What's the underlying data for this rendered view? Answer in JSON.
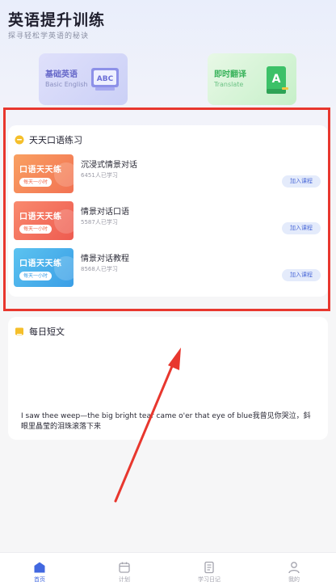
{
  "header": {
    "title": "英语提升训练",
    "subtitle": "探寻轻松学英语的秘诀"
  },
  "features": [
    {
      "title": "基础英语",
      "subtitle": "Basic English",
      "icon": "abc-book-icon",
      "icon_text": "ABC"
    },
    {
      "title": "即时翻译",
      "subtitle": "Translate",
      "icon": "translate-book-icon",
      "icon_text": "A"
    }
  ],
  "practice": {
    "title": "天天口语练习",
    "icon": "chat-bubble-icon",
    "courses": [
      {
        "thumb_title": "口语天天练",
        "thumb_tag": "每天一小时",
        "name": "沉浸式情景对话",
        "count": "6451人已学习",
        "join": "加入课程"
      },
      {
        "thumb_title": "口语天天练",
        "thumb_tag": "每天一小时",
        "name": "情景对话口语",
        "count": "5587人已学习",
        "join": "加入课程"
      },
      {
        "thumb_title": "口语天天练",
        "thumb_tag": "每天一小时",
        "name": "情景对话教程",
        "count": "8568人已学习",
        "join": "加入课程"
      }
    ]
  },
  "daily": {
    "title": "每日短文",
    "icon": "book-icon",
    "text": "I saw thee weep—the big bright tear came o'er that eye of blue我曾见你哭泣，鈄眼里晶莹的泪珠滚落下来"
  },
  "tabs": [
    {
      "label": "首页",
      "icon": "home-icon",
      "active": true
    },
    {
      "label": "计划",
      "icon": "calendar-icon",
      "active": false
    },
    {
      "label": "学习日记",
      "icon": "notebook-icon",
      "active": false
    },
    {
      "label": "我的",
      "icon": "user-icon",
      "active": false
    }
  ],
  "colors": {
    "accent": "#4268e0",
    "highlight_border": "#e8372e",
    "annotation_arrow": "#e8372e"
  }
}
